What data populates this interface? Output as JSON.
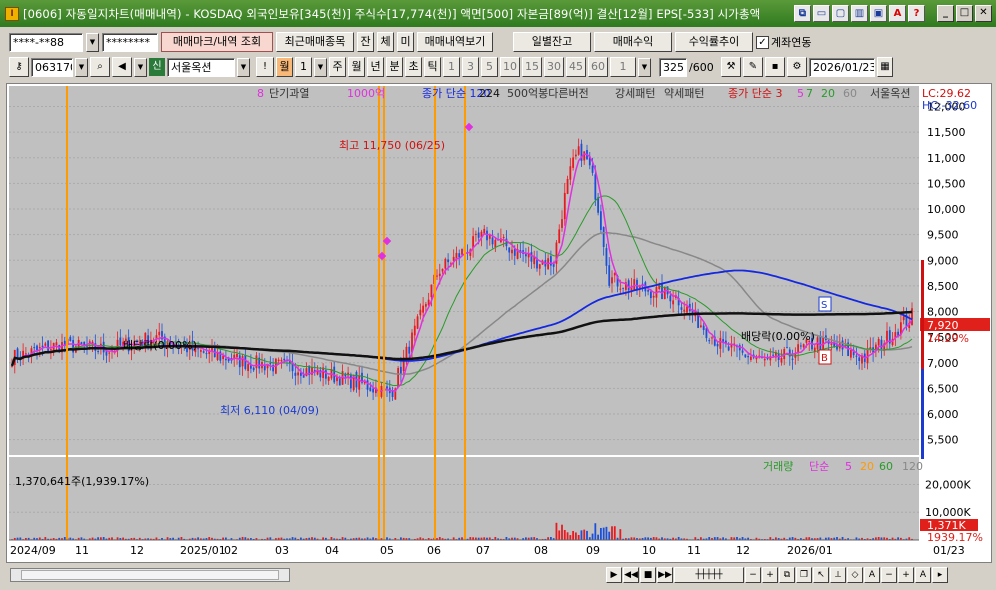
{
  "window": {
    "title": "[0606] 자동일지차트(매매내역) - KOSDAQ 외국인보유[345(천)] 주식수[17,774(천)] 액면[500] 자본금[89(억)] 결산[12월] EPS[-533] 시가총액"
  },
  "toolbar1": {
    "account": "****-**88",
    "password": "********",
    "btn_trade_mark": "매매마크/내역 조회",
    "btn_recent": "최근매매종목",
    "btn_jan": "잔",
    "btn_che": "체",
    "btn_mi": "미",
    "btn_trade_view": "매매내역보기",
    "btn_daily_balance": "일별잔고",
    "btn_profit": "매매수익",
    "btn_return_trend": "수익률추이",
    "linked_label": "계좌연동",
    "linked_checked": "✓"
  },
  "toolbar2": {
    "code": "063170",
    "market_badge": "신",
    "stock_name": "서울옥션",
    "periods": [
      "월",
      "1",
      "주",
      "월",
      "년",
      "분",
      "초",
      "틱",
      "1",
      "3",
      "5",
      "10",
      "15",
      "30",
      "45",
      "60",
      "1"
    ],
    "count": "325",
    "count_total": "/600",
    "date": "2026/01/23"
  },
  "chart_data": {
    "type": "candlestick",
    "title": "",
    "indicator_header": [
      "8",
      "단기과열",
      "1000억",
      "종가 단순 120",
      "224",
      "500억봉다른버전",
      "강세패턴",
      "약세패턴",
      "종가 단순 3",
      "5",
      "7",
      "20",
      "60",
      "서울옥션"
    ],
    "price_axis": {
      "labels": [
        "12,000",
        "11,500",
        "11,000",
        "10,500",
        "10,000",
        "9,500",
        "9,000",
        "8,500",
        "8,000",
        "7,500",
        "7,000",
        "6,500",
        "6,000",
        "5,500"
      ],
      "min": 5200,
      "max": 12400
    },
    "lc_label": "LC:29.62",
    "hc_label": "HC:-32.60",
    "current_price": "7,920",
    "current_change": "14.29%",
    "high_annotation": "최고 11,750 (06/25)",
    "low_annotation": "최저 6,110 (04/09)",
    "dividend_left": "배당락(0.00%)",
    "dividend_right": "배당락(0.00%)",
    "volume_header": [
      "거래량",
      "단순",
      "5",
      "20",
      "60",
      "120"
    ],
    "volume_note": "1,370,641주(1,939.17%)",
    "volume_axis": {
      "labels": [
        "20,000K",
        "10,000K"
      ],
      "max": 27000
    },
    "current_volume": "1,371K",
    "current_volume_pct": "1939.17%",
    "x_labels": [
      "2024/09",
      "11",
      "12",
      "2025/01",
      "02",
      "03",
      "04",
      "05",
      "06",
      "07",
      "08",
      "09",
      "10",
      "11",
      "12",
      "2026/01"
    ],
    "last_date_label": "01/23",
    "monthly_closes": [
      7100,
      7350,
      7250,
      7500,
      7200,
      7000,
      6900,
      6700,
      6400,
      8800,
      9500,
      9000,
      8900,
      8500,
      8300,
      7300,
      7000,
      7400,
      7100,
      7920
    ],
    "marker_s": "S",
    "marker_b": "B"
  },
  "colors": {
    "up": "#e8191f",
    "down": "#1a4fd8",
    "ma120": "#1428e0",
    "ma224": "#111111",
    "ma60": "#888888",
    "ma20": "#2a9a2a",
    "ma5": "#e030e0",
    "vline": "#ff9a00",
    "price_box": "#e0201a"
  }
}
